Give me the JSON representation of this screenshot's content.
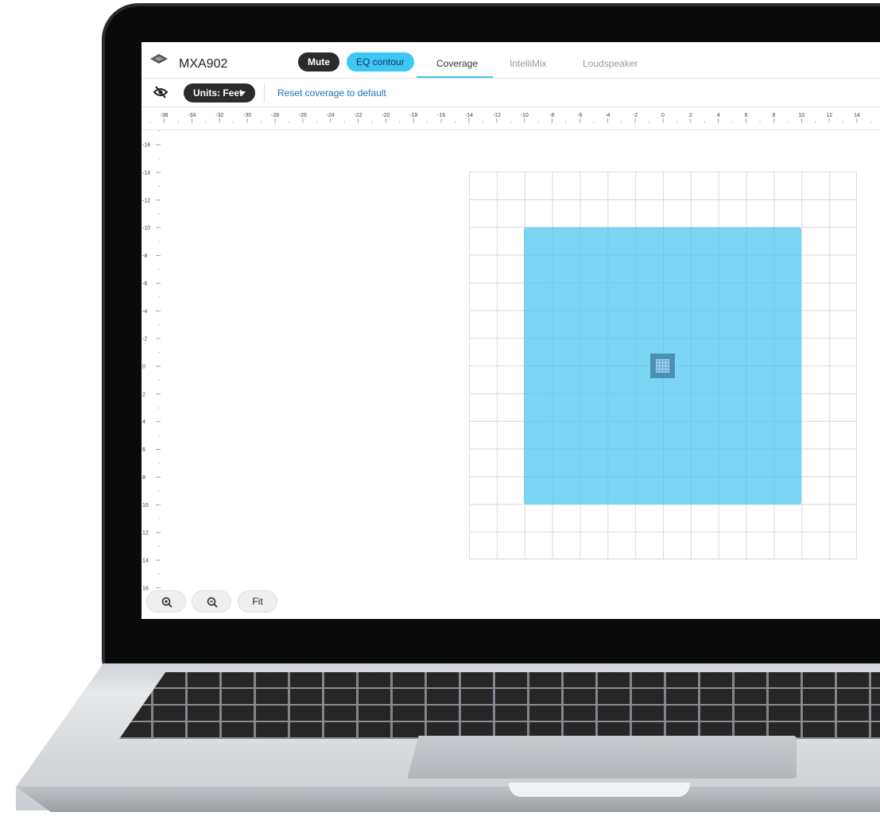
{
  "header": {
    "device_icon": "device-diamond-icon",
    "device_name": "MXA902",
    "mute_label": "Mute",
    "eq_label": "EQ contour",
    "tabs": [
      {
        "label": "Coverage",
        "active": true
      },
      {
        "label": "IntelliMix",
        "active": false
      },
      {
        "label": "Loudspeaker",
        "active": false
      }
    ]
  },
  "toolbar": {
    "visibility_icon": "eye-off-icon",
    "units_label": "Units: Feet",
    "reset_label": "Reset coverage to default"
  },
  "rulers": {
    "x_ticks": [
      "-36",
      "-34",
      "-32",
      "-30",
      "-28",
      "-26",
      "-24",
      "-22",
      "-20",
      "-18",
      "-16",
      "-14",
      "-12",
      "-10",
      "-8",
      "-6",
      "-4",
      "-2",
      "0",
      "2",
      "4",
      "6",
      "8",
      "10",
      "12",
      "14"
    ],
    "y_ticks": [
      "-16",
      "-14",
      "-12",
      "-10",
      "-8",
      "-6",
      "-4",
      "-2",
      "0",
      "2",
      "4",
      "6",
      "8",
      "10",
      "12",
      "14",
      "16"
    ]
  },
  "coverage_area": {
    "x_range_ft": [
      -10,
      10
    ],
    "y_range_ft": [
      -10,
      10
    ],
    "color": "#3cc3f0"
  },
  "controls": {
    "zoom_in_icon": "zoom-in-icon",
    "zoom_out_icon": "zoom-out-icon",
    "fit_label": "Fit"
  },
  "colors": {
    "accent": "#3cc7f5",
    "dark_button": "#2b2b2b",
    "link": "#1d6fb8"
  }
}
